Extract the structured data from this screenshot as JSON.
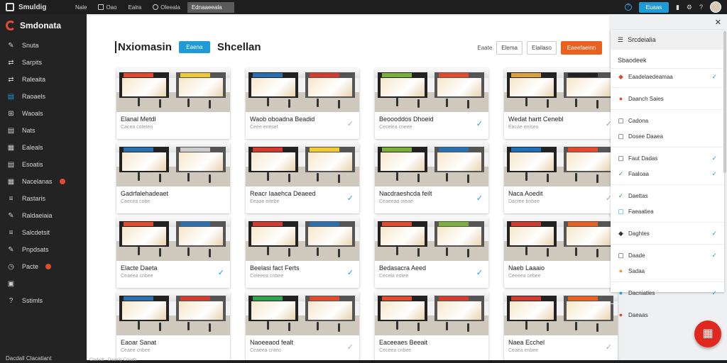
{
  "topbar": {
    "brand": "Smuldig",
    "tabs": [
      "Nale",
      "Oao",
      "Ealra",
      "Oleeala",
      "Ednaaeeala"
    ],
    "button": "Euaas"
  },
  "sidebar": {
    "brand": "Smdonata",
    "items": [
      {
        "icon": "wrench-icon",
        "label": "Snuta"
      },
      {
        "icon": "swap-icon",
        "label": "Sarpits"
      },
      {
        "icon": "swap-icon",
        "label": "Raleaita"
      },
      {
        "icon": "grid-icon",
        "label": "Raoaels",
        "active": true
      },
      {
        "icon": "tree-icon",
        "label": "Waoals"
      },
      {
        "icon": "grid-icon",
        "label": "Nats"
      },
      {
        "icon": "gallery-icon",
        "label": "Ealeals"
      },
      {
        "icon": "grid-icon",
        "label": "Esoatis"
      },
      {
        "icon": "gallery-icon",
        "label": "Nacelanas",
        "badge": true
      },
      {
        "icon": "list-icon",
        "label": "Rastaris"
      },
      {
        "icon": "wrench-icon",
        "label": "Raldaeiaia"
      },
      {
        "icon": "list-icon",
        "label": "Salcdetsit"
      },
      {
        "icon": "wrench-icon",
        "label": "Pnpdsats"
      },
      {
        "icon": "clock-icon",
        "label": "Pacte",
        "badge": true
      },
      {
        "icon": "sidebar-grid-icon",
        "label": ""
      },
      {
        "icon": "help-icon",
        "label": "Sstimls"
      }
    ],
    "footer": "Dacdall Clacatiant"
  },
  "main": {
    "title": "Nxiomasin",
    "blue_button": "Eaena",
    "subtitle": "Shcellan",
    "right_label": "Eaate",
    "right_button": "Elema",
    "right_button2": "Elailaso",
    "orange_button": "Eaeefaeinn",
    "cards": [
      {
        "caption": "Elanal Metdl",
        "sub": "Cacea coteteo",
        "check": "none"
      },
      {
        "caption": "Waob oboadna Beadid",
        "sub": "Ceee eneset",
        "check": "gray"
      },
      {
        "caption": "Beoooddos Dhoeid",
        "sub": "Cecelea cneee",
        "check": "blue"
      },
      {
        "caption": "Wedat hartt Cenebl",
        "sub": "Eacae eniseo",
        "check": "gray"
      },
      {
        "caption": "Gadrfalehadeaet",
        "sub": "Caecea cobe",
        "check": "none"
      },
      {
        "caption": "Reacr Iaaehca Deaeed",
        "sub": "Eeaae eitebe",
        "check": "blue"
      },
      {
        "caption": "Nacdraeshcda feilt",
        "sub": "Ceaeeaa oteae",
        "check": "blue"
      },
      {
        "caption": "Naca Aoedit",
        "sub": "Dacree bnbee",
        "check": "gray"
      },
      {
        "caption": "Elacte Daeta",
        "sub": "Ceaeea cnbee",
        "check": "blue"
      },
      {
        "caption": "Beelasi fact Ferts",
        "sub": "Celeeea cnbee",
        "check": "blue"
      },
      {
        "caption": "Bedasacra Aeed",
        "sub": "Cecela eotee",
        "check": "blue"
      },
      {
        "caption": "Naeb Laaaio",
        "sub": "Ceeeea cebee",
        "check": "none"
      },
      {
        "caption": "Eaoar Sanat",
        "sub": "Ceaee cnbee",
        "check": "none"
      },
      {
        "caption": "Naoeeaod fealt",
        "sub": "Ceaeea cnteo",
        "check": "gray"
      },
      {
        "caption": "Eaceeaes Beeait",
        "sub": "Ceceea cnbee",
        "check": "none"
      },
      {
        "caption": "Naea Ecchel",
        "sub": "Ceaea enbee",
        "check": "gray"
      }
    ]
  },
  "rpanel": {
    "header": "Srcdeialia",
    "section": "Sbaodeek",
    "rows": [
      {
        "icon": "tag-icon",
        "color": "red",
        "label": "Eaadelaedeamaa",
        "check": true
      },
      {
        "divider": true
      },
      {
        "icon": "circle-icon",
        "color": "red",
        "label": "Daanch Saies",
        "check": false
      },
      {
        "divider": true
      },
      {
        "icon": "doc-icon",
        "color": "",
        "label": "Cadona",
        "check": false
      },
      {
        "icon": "doc-icon",
        "color": "",
        "label": "Dosee Daaea",
        "check": false
      },
      {
        "divider": true
      },
      {
        "icon": "doc-icon",
        "color": "",
        "label": "Faut Dadas",
        "check": true
      },
      {
        "icon": "check-icon",
        "color": "green",
        "label": "Faaloaa",
        "check": true
      },
      {
        "divider": true
      },
      {
        "icon": "check-icon",
        "color": "green",
        "label": "Daettas",
        "check": false
      },
      {
        "icon": "doc-icon",
        "color": "blue",
        "label": "Faeaatiea",
        "check": false
      },
      {
        "divider": true
      },
      {
        "icon": "tag-icon",
        "color": "",
        "label": "Daghtes",
        "check": true
      },
      {
        "divider": true
      },
      {
        "icon": "doc-icon",
        "color": "",
        "label": "Daade",
        "check": true
      },
      {
        "icon": "circle-icon",
        "color": "orange",
        "label": "Sadaa",
        "check": false
      },
      {
        "divider": true
      },
      {
        "icon": "circle-icon",
        "color": "blue",
        "label": "Dacniatles",
        "check": true
      },
      {
        "divider": true
      },
      {
        "icon": "circle-icon",
        "color": "red",
        "label": "Daeaas",
        "check": false
      }
    ]
  },
  "bottombar": "Cladedt - Daaeliy Coaats"
}
